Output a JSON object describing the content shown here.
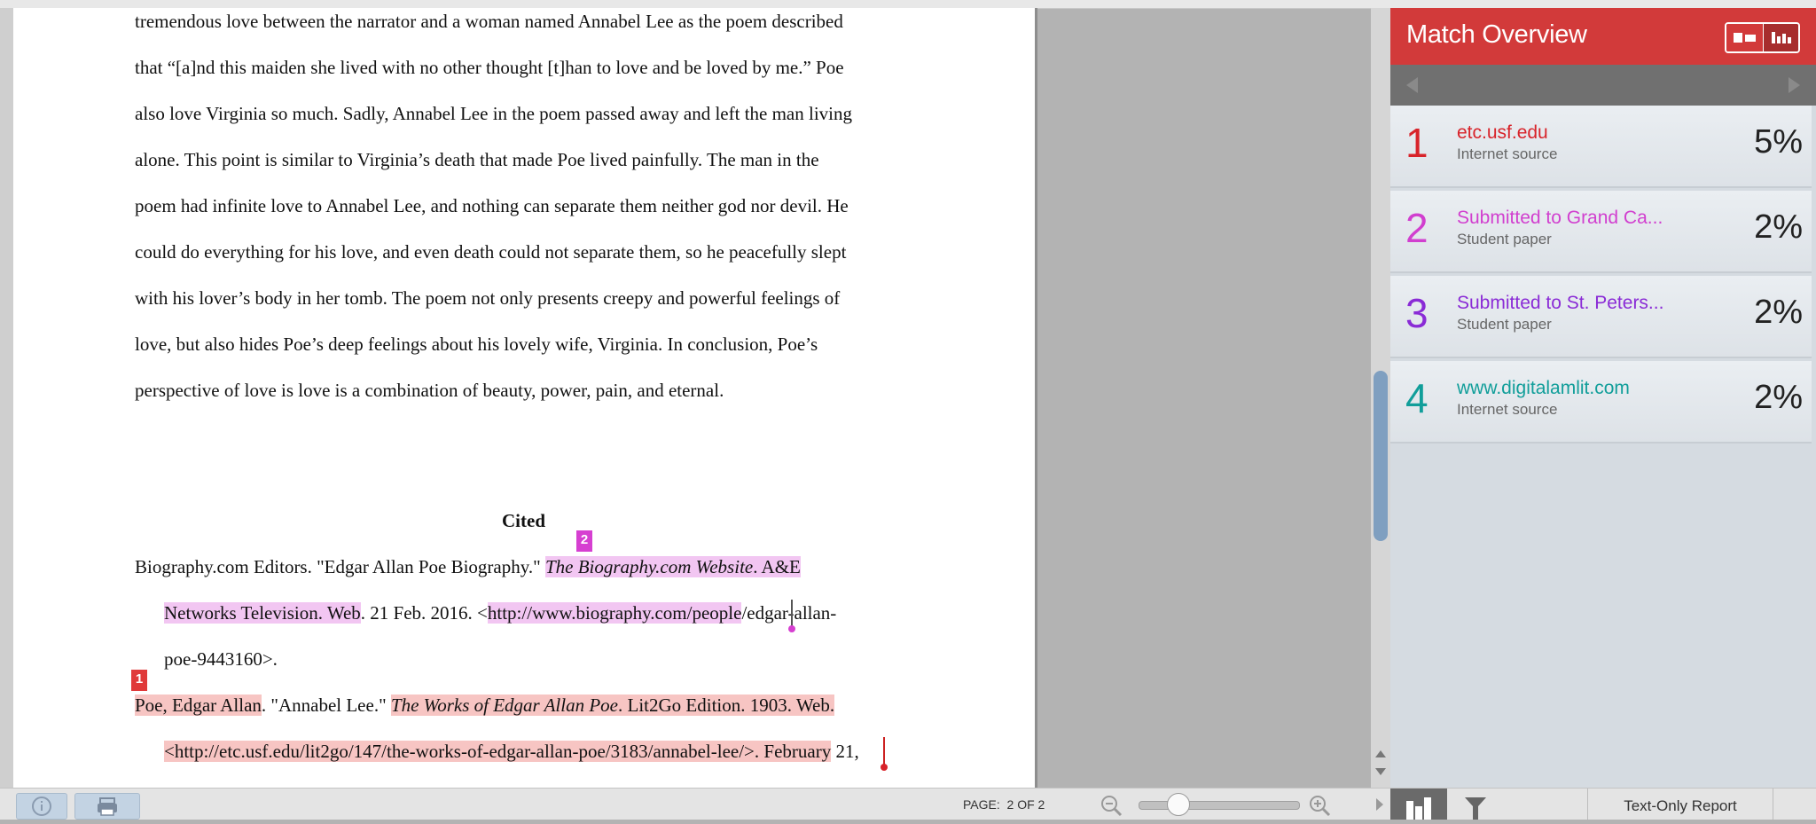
{
  "document": {
    "lines": [
      "tremendous love between the narrator and a woman named Annabel Lee as the poem described",
      "that “[a]nd this maiden she lived with no other thought [t]han to love and be loved by me.” Poe",
      "also love Virginia so much. Sadly, Annabel Lee in the poem passed away and left the man living",
      "alone. This point is similar to Virginia’s death that made Poe lived painfully. The man in the",
      "poem had infinite love to Annabel Lee, and nothing can separate them neither god nor devil. He",
      "could do everything for his love, and even death could not separate them, so he peacefully slept",
      "with his lover’s body in her tomb. The poem not only presents creepy and powerful feelings of",
      "love, but also hides Poe’s deep feelings about his lovely wife, Virginia. In conclusion, Poe’s",
      "perspective of love is love is a combination of beauty, power, pain, and eternal."
    ],
    "cited_heading": "Cited",
    "citation1": {
      "marker": "2",
      "l1_plain": "Biography.com Editors. \"Edgar Allan Poe Biography.\" ",
      "l1_italic": "The Biography.com Website",
      "l1_hl": ". A&E",
      "l2_hl": "Networks Television. Web",
      "l2_plain": ". 21 Feb. 2016. <",
      "l2_hl2": "http://www.biography.com/people",
      "l2_rest": "/edgar-allan-",
      "l3": "poe-9443160>."
    },
    "citation2": {
      "marker": "1",
      "l1_hl": "Poe, Edgar Allan",
      "l1_plain": ". \"Annabel Lee.\" ",
      "l1_italic": "The Works of Edgar Allan Poe",
      "l1_hl2": ". Lit2Go Edition. 1903. Web.",
      "l2_hl": "<http://etc.usf.edu/lit2go/147/the-works-of-edgar-allan-poe/3183/annabel-lee/>. February",
      "l2_rest": " 21,"
    }
  },
  "panel": {
    "title": "Match Overview",
    "matches": [
      {
        "num": "1",
        "name": "etc.usf.edu",
        "type": "Internet source",
        "pct": "5%",
        "color": "#d8232a"
      },
      {
        "num": "2",
        "name": "Submitted to Grand Ca...",
        "type": "Student paper",
        "pct": "2%",
        "color": "#d13fcf"
      },
      {
        "num": "3",
        "name": "Submitted to St. Peters...",
        "type": "Student paper",
        "pct": "2%",
        "color": "#8a2bd6"
      },
      {
        "num": "4",
        "name": "www.digitalamlit.com",
        "type": "Internet source",
        "pct": "2%",
        "color": "#119e9a"
      }
    ]
  },
  "toolbar": {
    "page_label": "PAGE:",
    "page_value": "2 OF 2",
    "text_only": "Text-Only Report"
  },
  "colors": {
    "panel_header": "#d23a3a",
    "highlight_match2": "#f2c6f2",
    "highlight_match1": "#f7c5c3"
  }
}
